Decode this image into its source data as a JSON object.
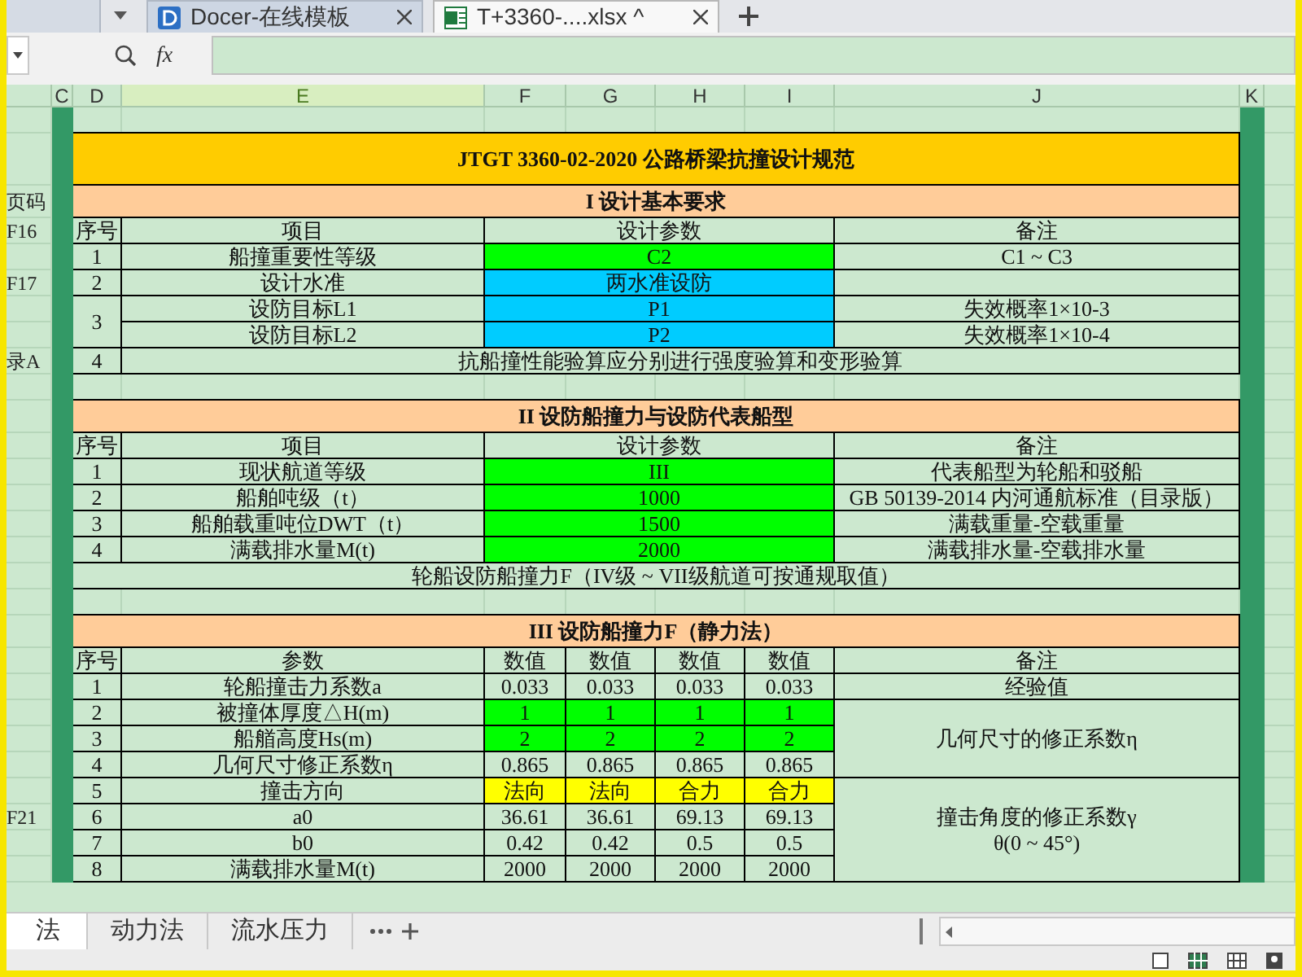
{
  "top_tabs": [
    {
      "label": "Docer-在线模板",
      "selected": false,
      "kind": "docer"
    },
    {
      "label": "T+3360-....xlsx ^",
      "selected": true,
      "kind": "xlsx"
    }
  ],
  "formula_bar": {
    "label": "fx"
  },
  "sheet": {
    "column_headers": [
      {
        "label": "C",
        "selected": false
      },
      {
        "label": "D",
        "selected": false
      },
      {
        "label": "E",
        "selected": true
      },
      {
        "label": "F",
        "selected": false
      },
      {
        "label": "G",
        "selected": false
      },
      {
        "label": "H",
        "selected": false
      },
      {
        "label": "I",
        "selected": false
      },
      {
        "label": "J",
        "selected": false
      },
      {
        "label": "K",
        "selected": false
      }
    ],
    "rows": [
      {
        "kind": "blank"
      },
      {
        "kind": "title",
        "text": "JTGT 3360-02-2020 公路桥梁抗撞设计规范",
        "color": "#ffcc00"
      },
      {
        "kind": "section",
        "side": "页码",
        "text": "I 设计基本要求",
        "color": "#ffcc99"
      },
      {
        "kind": "header",
        "side": "F16",
        "no": "序号",
        "item": "项目",
        "values": [
          {
            "text": "设计参数"
          }
        ],
        "note": "备注"
      },
      {
        "kind": "data",
        "no": "1",
        "item": "船撞重要性等级",
        "values": [
          {
            "text": "C2",
            "color": "#00ff00"
          }
        ],
        "note": "C1 ~ C3"
      },
      {
        "kind": "data",
        "side": "F17",
        "no": "2",
        "item": "设计水准",
        "values": [
          {
            "text": "两水准设防",
            "color": "#00ccff"
          }
        ]
      },
      {
        "kind": "data",
        "no": "3",
        "item": "设防目标L1",
        "values": [
          {
            "text": "P1",
            "color": "#00ccff"
          }
        ],
        "note": "失效概率1×10-3"
      },
      {
        "kind": "data",
        "no_merged_above": true,
        "item": "设防目标L2",
        "values": [
          {
            "text": "P2",
            "color": "#00ccff"
          }
        ],
        "note": "失效概率1×10-4"
      },
      {
        "kind": "wide",
        "side": "录A",
        "no": "4",
        "text": "抗船撞性能验算应分别进行强度验算和变形验算"
      },
      {
        "kind": "blank"
      },
      {
        "kind": "section",
        "text": "II 设防船撞力与设防代表船型",
        "color": "#ffcc99"
      },
      {
        "kind": "header",
        "no": "序号",
        "item": "项目",
        "values": [
          {
            "text": "设计参数"
          }
        ],
        "note": "备注"
      },
      {
        "kind": "data",
        "no": "1",
        "item": "现状航道等级",
        "values": [
          {
            "text": "III",
            "color": "#00ff00"
          }
        ],
        "note": "代表船型为轮船和驳船"
      },
      {
        "kind": "data",
        "no": "2",
        "item": "船舶吨级（t）",
        "values": [
          {
            "text": "1000",
            "color": "#00ff00"
          }
        ],
        "note": "GB 50139-2014 内河通航标准（目录版）"
      },
      {
        "kind": "data",
        "no": "3",
        "item": "船舶载重吨位DWT（t）",
        "values": [
          {
            "text": "1500",
            "color": "#00ff00"
          }
        ],
        "note": "满载重量-空载重量"
      },
      {
        "kind": "data",
        "no": "4",
        "item": "满载排水量M(t)",
        "values": [
          {
            "text": "2000",
            "color": "#00ff00"
          }
        ],
        "note": "满载排水量-空载排水量"
      },
      {
        "kind": "note",
        "text": "轮船设防船撞力F（IV级 ~ VII级航道可按通规取值）"
      },
      {
        "kind": "blank"
      },
      {
        "kind": "section",
        "text": "III 设防船撞力F（静力法）",
        "color": "#ffcc99"
      },
      {
        "kind": "header",
        "no": "序号",
        "item": "参数",
        "values": [
          {
            "text": "数值"
          },
          {
            "text": "数值"
          },
          {
            "text": "数值"
          },
          {
            "text": "数值"
          }
        ],
        "note": "备注"
      },
      {
        "kind": "data",
        "no": "1",
        "item": "轮船撞击力系数a",
        "values": [
          {
            "text": "0.033"
          },
          {
            "text": "0.033"
          },
          {
            "text": "0.033"
          },
          {
            "text": "0.033"
          }
        ],
        "note": "经验值"
      },
      {
        "kind": "data",
        "no": "2",
        "item": "被撞体厚度△H(m)",
        "values": [
          {
            "text": "1",
            "color": "#00ff00"
          },
          {
            "text": "1",
            "color": "#00ff00"
          },
          {
            "text": "1",
            "color": "#00ff00"
          },
          {
            "text": "1",
            "color": "#00ff00"
          }
        ],
        "note": "几何尺寸的修正系数η"
      },
      {
        "kind": "data",
        "note_merged_above": true,
        "no": "3",
        "item": "船艏高度Hs(m)",
        "values": [
          {
            "text": "2",
            "color": "#00ff00"
          },
          {
            "text": "2",
            "color": "#00ff00"
          },
          {
            "text": "2",
            "color": "#00ff00"
          },
          {
            "text": "2",
            "color": "#00ff00"
          }
        ]
      },
      {
        "kind": "data",
        "note_merged_above": true,
        "no": "4",
        "item": "几何尺寸修正系数η",
        "values": [
          {
            "text": "0.865"
          },
          {
            "text": "0.865"
          },
          {
            "text": "0.865"
          },
          {
            "text": "0.865"
          }
        ]
      },
      {
        "kind": "data",
        "no": "5",
        "item": "撞击方向",
        "values": [
          {
            "text": "法向",
            "color": "#ffff00"
          },
          {
            "text": "法向",
            "color": "#ffff00"
          },
          {
            "text": "合力",
            "color": "#ffff00"
          },
          {
            "text": "合力",
            "color": "#ffff00"
          }
        ],
        "note": [
          "撞击角度的修正系数γ",
          "θ(0 ~ 45°)"
        ]
      },
      {
        "kind": "data",
        "note_merged_above": true,
        "side": "F21",
        "no": "6",
        "item": "a0",
        "values": [
          {
            "text": "36.61"
          },
          {
            "text": "36.61"
          },
          {
            "text": "69.13"
          },
          {
            "text": "69.13"
          }
        ]
      },
      {
        "kind": "data",
        "note_merged_above": true,
        "no": "7",
        "item": "b0",
        "values": [
          {
            "text": "0.42"
          },
          {
            "text": "0.42"
          },
          {
            "text": "0.5"
          },
          {
            "text": "0.5"
          }
        ]
      },
      {
        "kind": "data",
        "note_merged_above": true,
        "no": "8",
        "item": "满载排水量M(t)",
        "values": [
          {
            "text": "2000"
          },
          {
            "text": "2000"
          },
          {
            "text": "2000"
          },
          {
            "text": "2000"
          }
        ]
      }
    ]
  },
  "sheet_tabs": [
    {
      "label": "法",
      "selected": true
    },
    {
      "label": "动力法",
      "selected": false
    },
    {
      "label": "流水压力",
      "selected": false
    }
  ]
}
